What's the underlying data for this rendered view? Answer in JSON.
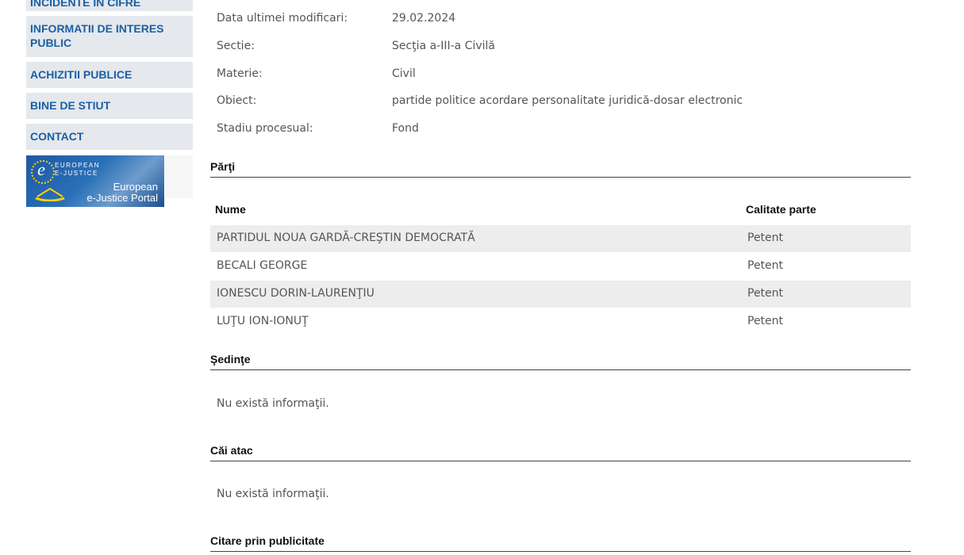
{
  "sidebar": {
    "items": [
      {
        "label": "INCIDENTE IN CIFRE"
      },
      {
        "label": "INFORMATII DE INTERES PUBLIC"
      },
      {
        "label": "ACHIZITII PUBLICE"
      },
      {
        "label": "BINE DE STIUT"
      },
      {
        "label": "CONTACT"
      }
    ],
    "banner": {
      "logo_letter": "e",
      "logo_text": "EUROPEAN E-JUSTICE",
      "portal_line1": "European",
      "portal_line2": "e-Justice Portal"
    }
  },
  "details": [
    {
      "label": "Data ultimei modificari:",
      "value": "29.02.2024"
    },
    {
      "label": "Sectie:",
      "value": "Secţia a-III-a Civilă"
    },
    {
      "label": "Materie:",
      "value": "Civil"
    },
    {
      "label": "Obiect:",
      "value": "partide politice acordare personalitate juridică-dosar electronic"
    },
    {
      "label": "Stadiu procesual:",
      "value": "Fond"
    }
  ],
  "parti": {
    "title": "Părţi",
    "columns": [
      "Nume",
      "Calitate parte"
    ],
    "rows": [
      {
        "nume": "PARTIDUL NOUA GARDĂ-CREŞTIN DEMOCRATĂ",
        "calitate": "Petent"
      },
      {
        "nume": "BECALI GEORGE",
        "calitate": "Petent"
      },
      {
        "nume": "IONESCU DORIN-LAURENŢIU",
        "calitate": "Petent"
      },
      {
        "nume": "LUŢU ION-IONUŢ",
        "calitate": "Petent"
      }
    ]
  },
  "sedinte": {
    "title": "Şedinţe",
    "empty": "Nu există informaţii."
  },
  "cai_atac": {
    "title": "Căi atac",
    "empty": "Nu există informaţii."
  },
  "citare": {
    "title": "Citare prin publicitate"
  },
  "colors": {
    "link": "#1a5fa6",
    "sidebar_bg": "#e5e8ec",
    "row_alt": "#ededed",
    "text": "#555555"
  }
}
